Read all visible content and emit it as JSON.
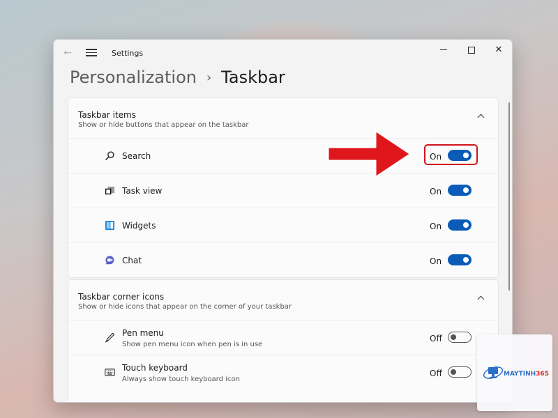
{
  "window": {
    "app_title": "Settings",
    "controls": {
      "minimize": "—",
      "maximize": "☐",
      "close": "✕"
    }
  },
  "breadcrumb": {
    "parent": "Personalization",
    "separator": "›",
    "current": "Taskbar"
  },
  "sections": [
    {
      "title": "Taskbar items",
      "description": "Show or hide buttons that appear on the taskbar",
      "items": [
        {
          "label": "Search",
          "state": "On",
          "icon": "search-icon"
        },
        {
          "label": "Task view",
          "state": "On",
          "icon": "task-view-icon"
        },
        {
          "label": "Widgets",
          "state": "On",
          "icon": "widgets-icon"
        },
        {
          "label": "Chat",
          "state": "On",
          "icon": "chat-icon"
        }
      ]
    },
    {
      "title": "Taskbar corner icons",
      "description": "Show or hide icons that appear on the corner of your taskbar",
      "items": [
        {
          "label": "Pen menu",
          "sublabel": "Show pen menu icon when pen is in use",
          "state": "Off",
          "icon": "pen-icon"
        },
        {
          "label": "Touch keyboard",
          "sublabel": "Always show touch keyboard icon",
          "state": "Off",
          "icon": "keyboard-icon"
        }
      ]
    }
  ],
  "annotation": {
    "color": "#d0141b",
    "target": "Search toggle"
  },
  "watermark": {
    "brand": "MAYTINH",
    "brand_accent": "365"
  },
  "colors": {
    "accent": "#0a5cb8",
    "window_bg": "#f3f3f3",
    "card_bg": "#fbfbfb"
  }
}
